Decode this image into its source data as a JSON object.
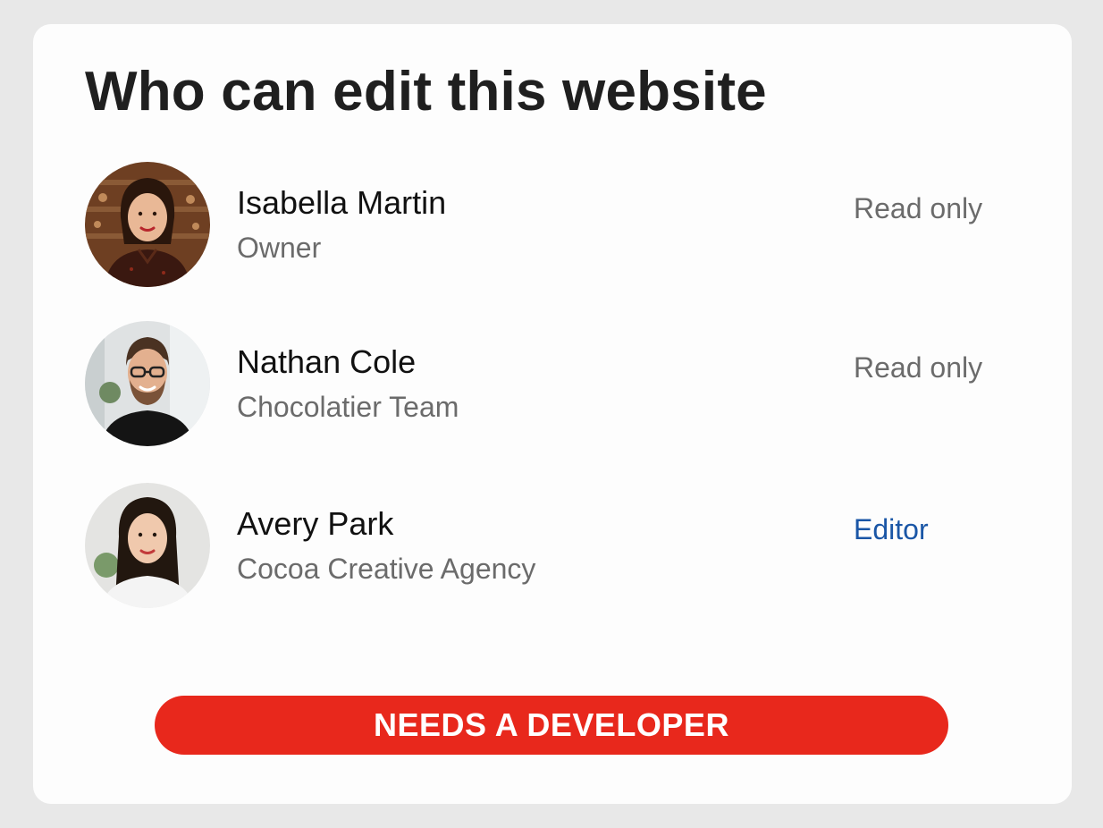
{
  "title": "Who can edit this website",
  "members": [
    {
      "name": "Isabella Martin",
      "subtitle": "Owner",
      "permission": "Read only"
    },
    {
      "name": "Nathan Cole",
      "subtitle": "Chocolatier Team",
      "permission": "Read only"
    },
    {
      "name": "Avery Park",
      "subtitle": "Cocoa Creative Agency",
      "permission": "Editor"
    }
  ],
  "cta": {
    "label": "NEEDS A DEVELOPER"
  },
  "colors": {
    "background": "#e8e8e8",
    "card": "#fdfdfd",
    "cta": "#e8281c",
    "editor_link": "#1a56a6",
    "muted_text": "#6b6b6b"
  }
}
